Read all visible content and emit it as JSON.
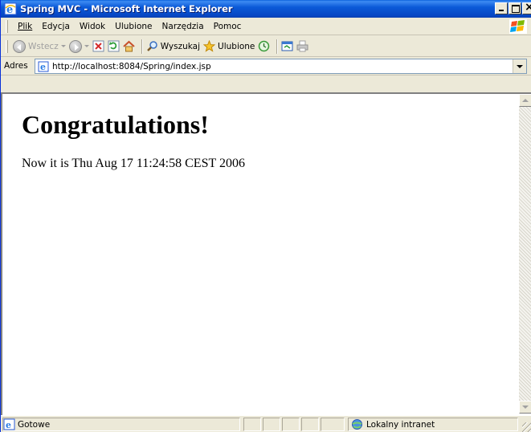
{
  "window": {
    "title": "Spring MVC - Microsoft Internet Explorer"
  },
  "menu": {
    "items": [
      {
        "label": "Plik",
        "accesskey": "P"
      },
      {
        "label": "Edycja",
        "accesskey": "E"
      },
      {
        "label": "Widok",
        "accesskey": "W"
      },
      {
        "label": "Ulubione",
        "accesskey": "U"
      },
      {
        "label": "Narzędzia",
        "accesskey": "N"
      },
      {
        "label": "Pomoc",
        "accesskey": "c"
      }
    ]
  },
  "toolbar": {
    "back_label": "Wstecz",
    "search_label": "Wyszukaj",
    "favorites_label": "Ulubione"
  },
  "address": {
    "label": "Adres",
    "url": "http://localhost:8084/Spring/index.jsp"
  },
  "page": {
    "heading": "Congratulations!",
    "body": "Now it is Thu Aug 17 11:24:58 CEST 2006"
  },
  "status": {
    "text": "Gotowe",
    "zone": "Lokalny intranet"
  },
  "colors": {
    "titlebar": "#0b5ad8",
    "chrome": "#ece9d8"
  }
}
